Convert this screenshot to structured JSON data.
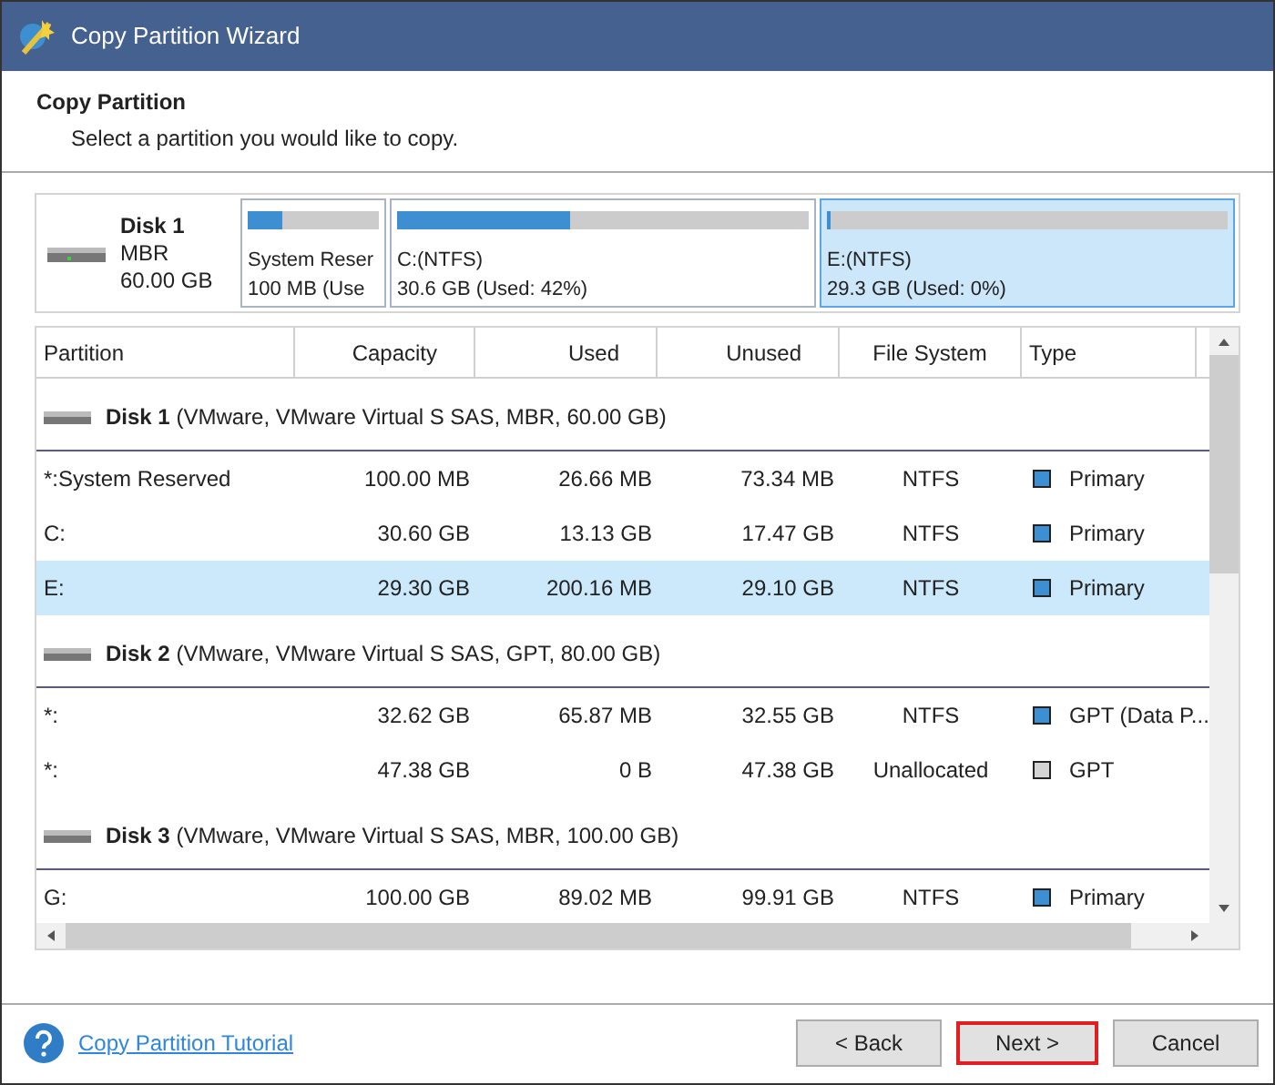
{
  "window": {
    "title": "Copy Partition Wizard"
  },
  "header": {
    "title": "Copy Partition",
    "subtitle": "Select a partition you would like to copy."
  },
  "disk_map": {
    "disk": {
      "name": "Disk 1",
      "style": "MBR",
      "size": "60.00 GB"
    },
    "partitions": [
      {
        "label": "System Reser",
        "detail": "100 MB (Use",
        "level": 0.27,
        "selected": false
      },
      {
        "label": "C:(NTFS)",
        "detail": "30.6 GB (Used: 42%)",
        "level": 0.42,
        "selected": false
      },
      {
        "label": "E:(NTFS)",
        "detail": "29.3 GB (Used: 0%)",
        "level": 0.0,
        "selected": true
      }
    ]
  },
  "table": {
    "columns": [
      "Partition",
      "Capacity",
      "Used",
      "Unused",
      "File System",
      "Type"
    ],
    "groups": [
      {
        "disk": "Disk 1",
        "details": "(VMware, VMware Virtual S SAS, MBR, 60.00 GB)",
        "rows": [
          {
            "cells": [
              "*:System Reserved",
              "100.00 MB",
              "26.66 MB",
              "73.34 MB",
              "NTFS",
              "Primary"
            ],
            "color": "#3d8fd1",
            "selected": false
          },
          {
            "cells": [
              "C:",
              "30.60 GB",
              "13.13 GB",
              "17.47 GB",
              "NTFS",
              "Primary"
            ],
            "color": "#3d8fd1",
            "selected": false
          },
          {
            "cells": [
              "E:",
              "29.30 GB",
              "200.16 MB",
              "29.10 GB",
              "NTFS",
              "Primary"
            ],
            "color": "#3d8fd1",
            "selected": true
          }
        ]
      },
      {
        "disk": "Disk 2",
        "details": "(VMware, VMware Virtual S SAS, GPT, 80.00 GB)",
        "rows": [
          {
            "cells": [
              "*:",
              "32.62 GB",
              "65.87 MB",
              "32.55 GB",
              "NTFS",
              "GPT (Data P..."
            ],
            "color": "#3d8fd1",
            "selected": false
          },
          {
            "cells": [
              "*:",
              "47.38 GB",
              "0 B",
              "47.38 GB",
              "Unallocated",
              "GPT"
            ],
            "color": "#d4d4d4",
            "selected": false
          }
        ]
      },
      {
        "disk": "Disk 3",
        "details": "(VMware, VMware Virtual S SAS, MBR, 100.00 GB)",
        "rows": [
          {
            "cells": [
              "G:",
              "100.00 GB",
              "89.02 MB",
              "99.91 GB",
              "NTFS",
              "Primary"
            ],
            "color": "#3d8fd1",
            "selected": false
          }
        ]
      }
    ]
  },
  "footer": {
    "help_link": "Copy Partition Tutorial",
    "buttons": [
      {
        "label": "< Back",
        "highlighted": false
      },
      {
        "label": "Next >",
        "highlighted": true
      },
      {
        "label": "Cancel",
        "highlighted": false
      }
    ]
  }
}
